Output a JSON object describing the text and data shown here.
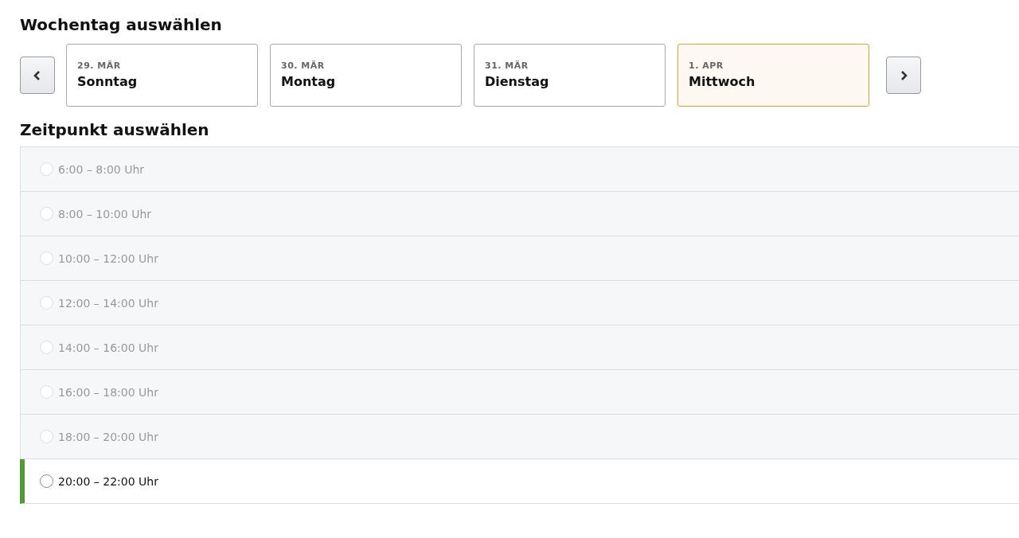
{
  "day_section": {
    "title": "Wochentag auswählen"
  },
  "days": [
    {
      "date": "29. MÄR",
      "weekday": "Sonntag",
      "selected": false
    },
    {
      "date": "30. MÄR",
      "weekday": "Montag",
      "selected": false
    },
    {
      "date": "31. MÄR",
      "weekday": "Dienstag",
      "selected": false
    },
    {
      "date": "1. APR",
      "weekday": "Mittwoch",
      "selected": true
    }
  ],
  "time_section": {
    "title": "Zeitpunkt auswählen"
  },
  "slots": [
    {
      "label": "6:00 – 8:00 Uhr",
      "disabled": true
    },
    {
      "label": "8:00 – 10:00 Uhr",
      "disabled": true
    },
    {
      "label": "10:00 – 12:00 Uhr",
      "disabled": true
    },
    {
      "label": "12:00 – 14:00 Uhr",
      "disabled": true
    },
    {
      "label": "14:00 – 16:00 Uhr",
      "disabled": true
    },
    {
      "label": "16:00 – 18:00 Uhr",
      "disabled": true
    },
    {
      "label": "18:00 – 20:00 Uhr",
      "disabled": true
    },
    {
      "label": "20:00 – 22:00 Uhr",
      "disabled": false
    }
  ]
}
